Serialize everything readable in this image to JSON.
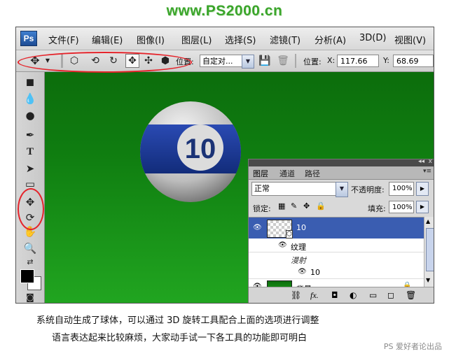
{
  "site_title": "www.PS2000.cn",
  "app": {
    "logo": "Ps"
  },
  "menu": [
    {
      "label": "文件(F)"
    },
    {
      "label": "编辑(E)"
    },
    {
      "label": "图像(I)"
    },
    {
      "label": "图层(L)"
    },
    {
      "label": "选择(S)"
    },
    {
      "label": "滤镜(T)"
    },
    {
      "label": "分析(A)"
    },
    {
      "label": "3D(D)"
    },
    {
      "label": "视图(V)"
    }
  ],
  "options": {
    "position_label": "位置:",
    "position_value": "自定对...",
    "position2_label": "位置:",
    "x_label": "X:",
    "x_value": "117.66",
    "y_label": "Y:",
    "y_value": "68.69"
  },
  "ball": {
    "number": "10",
    "colors": {
      "stripe": "#1f3f9e",
      "body": "#d8d8d8"
    }
  },
  "layers_panel": {
    "tabs": [
      "图层",
      "通道",
      "路径"
    ],
    "blend_mode": "正常",
    "opacity_label": "不透明度:",
    "opacity_value": "100%",
    "lock_label": "锁定:",
    "fill_label": "填充:",
    "fill_value": "100%",
    "layers": [
      {
        "name": "10"
      },
      {
        "name": "纹理"
      },
      {
        "name": "漫射"
      },
      {
        "name": "10"
      },
      {
        "name": "背景"
      }
    ]
  },
  "captions": {
    "line1": "系统自动生成了球体，可以通过 3D 旋转工具配合上面的选项进行调整",
    "line2": "语言表达起来比较麻烦，大家动手试一下各工具的功能即可明白"
  },
  "watermark": "PS 爱好者论出品",
  "colors": {
    "annotation": "#e5232a",
    "canvas": "#118a12",
    "title": "#3aa52a"
  }
}
